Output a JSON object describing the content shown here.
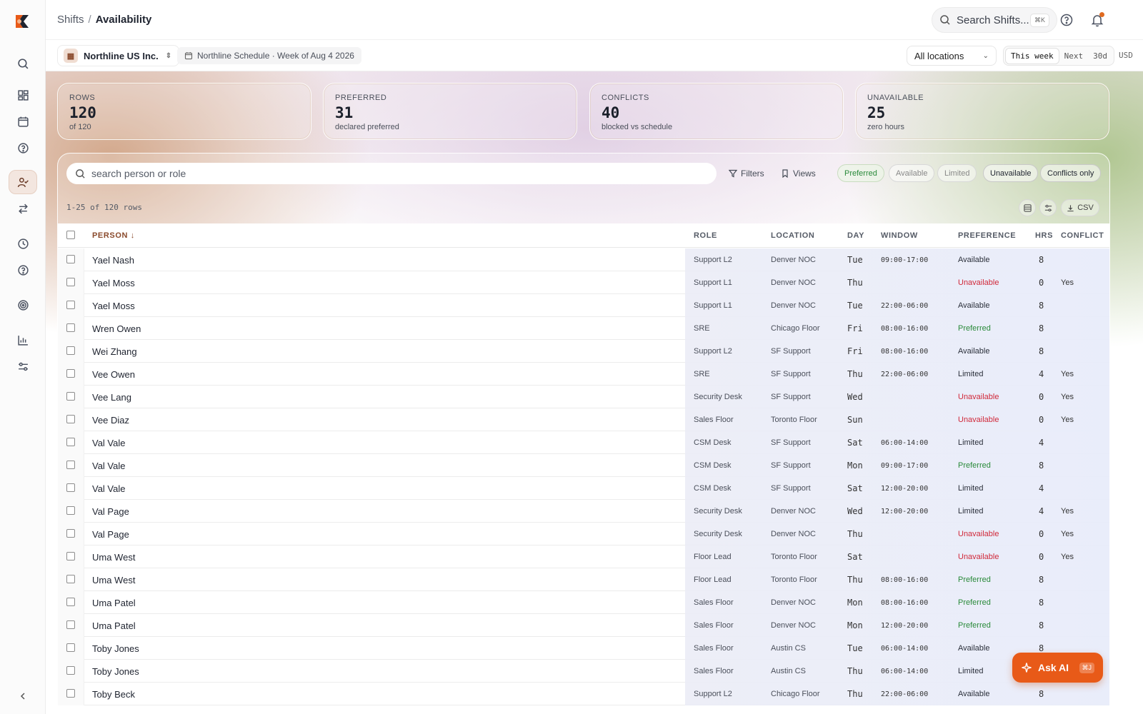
{
  "topbar": {
    "breadcrumb_parent": "Shifts",
    "breadcrumb_sep": "/",
    "breadcrumb_current": "Availability",
    "search_label": "Search Shifts...",
    "search_kbd": "⌘K"
  },
  "subbar": {
    "org_name": "Northline US Inc.",
    "schedule_label": "Northline Schedule · Week of Aug 4 2026",
    "location_value": "All locations",
    "ranges": [
      "This week",
      "Next",
      "30d"
    ],
    "active_range": "This week",
    "currency": "USD"
  },
  "stats": [
    {
      "label": "ROWS",
      "value": "120",
      "sub": "of 120"
    },
    {
      "label": "PREFERRED",
      "value": "31",
      "sub": "declared preferred"
    },
    {
      "label": "CONFLICTS",
      "value": "40",
      "sub": "blocked vs schedule"
    },
    {
      "label": "UNAVAILABLE",
      "value": "25",
      "sub": "zero hours"
    }
  ],
  "toolbar": {
    "search_placeholder": "search person or role",
    "filters_label": "Filters",
    "views_label": "Views",
    "chips": [
      "Preferred",
      "Available",
      "Limited",
      "Unavailable",
      "Conflicts only"
    ],
    "row_info": "1-25 of 120 rows",
    "csv_label": "CSV"
  },
  "table": {
    "headers": {
      "person": "PERSON",
      "role": "ROLE",
      "location": "LOCATION",
      "day": "DAY",
      "window": "WINDOW",
      "preference": "PREFERENCE",
      "hrs": "HRS",
      "conflict": "CONFLICT"
    },
    "sort_indicator": "↓",
    "rows": [
      {
        "person": "Yael Nash",
        "role": "Support L2",
        "location": "Denver NOC",
        "day": "Tue",
        "window": "09:00-17:00",
        "preference": "Available",
        "hrs": "8",
        "conflict": ""
      },
      {
        "person": "Yael Moss",
        "role": "Support L1",
        "location": "Denver NOC",
        "day": "Thu",
        "window": "",
        "preference": "Unavailable",
        "hrs": "0",
        "conflict": "Yes"
      },
      {
        "person": "Yael Moss",
        "role": "Support L1",
        "location": "Denver NOC",
        "day": "Tue",
        "window": "22:00-06:00",
        "preference": "Available",
        "hrs": "8",
        "conflict": ""
      },
      {
        "person": "Wren Owen",
        "role": "SRE",
        "location": "Chicago Floor",
        "day": "Fri",
        "window": "08:00-16:00",
        "preference": "Preferred",
        "hrs": "8",
        "conflict": ""
      },
      {
        "person": "Wei Zhang",
        "role": "Support L2",
        "location": "SF Support",
        "day": "Fri",
        "window": "08:00-16:00",
        "preference": "Available",
        "hrs": "8",
        "conflict": ""
      },
      {
        "person": "Vee Owen",
        "role": "SRE",
        "location": "SF Support",
        "day": "Thu",
        "window": "22:00-06:00",
        "preference": "Limited",
        "hrs": "4",
        "conflict": "Yes"
      },
      {
        "person": "Vee Lang",
        "role": "Security Desk",
        "location": "SF Support",
        "day": "Wed",
        "window": "",
        "preference": "Unavailable",
        "hrs": "0",
        "conflict": "Yes"
      },
      {
        "person": "Vee Diaz",
        "role": "Sales Floor",
        "location": "Toronto Floor",
        "day": "Sun",
        "window": "",
        "preference": "Unavailable",
        "hrs": "0",
        "conflict": "Yes"
      },
      {
        "person": "Val Vale",
        "role": "CSM Desk",
        "location": "SF Support",
        "day": "Sat",
        "window": "06:00-14:00",
        "preference": "Limited",
        "hrs": "4",
        "conflict": ""
      },
      {
        "person": "Val Vale",
        "role": "CSM Desk",
        "location": "SF Support",
        "day": "Mon",
        "window": "09:00-17:00",
        "preference": "Preferred",
        "hrs": "8",
        "conflict": ""
      },
      {
        "person": "Val Vale",
        "role": "CSM Desk",
        "location": "SF Support",
        "day": "Sat",
        "window": "12:00-20:00",
        "preference": "Limited",
        "hrs": "4",
        "conflict": ""
      },
      {
        "person": "Val Page",
        "role": "Security Desk",
        "location": "Denver NOC",
        "day": "Wed",
        "window": "12:00-20:00",
        "preference": "Limited",
        "hrs": "4",
        "conflict": "Yes"
      },
      {
        "person": "Val Page",
        "role": "Security Desk",
        "location": "Denver NOC",
        "day": "Thu",
        "window": "",
        "preference": "Unavailable",
        "hrs": "0",
        "conflict": "Yes"
      },
      {
        "person": "Uma West",
        "role": "Floor Lead",
        "location": "Toronto Floor",
        "day": "Sat",
        "window": "",
        "preference": "Unavailable",
        "hrs": "0",
        "conflict": "Yes"
      },
      {
        "person": "Uma West",
        "role": "Floor Lead",
        "location": "Toronto Floor",
        "day": "Thu",
        "window": "08:00-16:00",
        "preference": "Preferred",
        "hrs": "8",
        "conflict": ""
      },
      {
        "person": "Uma Patel",
        "role": "Sales Floor",
        "location": "Denver NOC",
        "day": "Mon",
        "window": "08:00-16:00",
        "preference": "Preferred",
        "hrs": "8",
        "conflict": ""
      },
      {
        "person": "Uma Patel",
        "role": "Sales Floor",
        "location": "Denver NOC",
        "day": "Mon",
        "window": "12:00-20:00",
        "preference": "Preferred",
        "hrs": "8",
        "conflict": ""
      },
      {
        "person": "Toby Jones",
        "role": "Sales Floor",
        "location": "Austin CS",
        "day": "Tue",
        "window": "06:00-14:00",
        "preference": "Available",
        "hrs": "8",
        "conflict": ""
      },
      {
        "person": "Toby Jones",
        "role": "Sales Floor",
        "location": "Austin CS",
        "day": "Thu",
        "window": "06:00-14:00",
        "preference": "Limited",
        "hrs": "",
        "conflict": ""
      },
      {
        "person": "Toby Beck",
        "role": "Support L2",
        "location": "Chicago Floor",
        "day": "Thu",
        "window": "22:00-06:00",
        "preference": "Available",
        "hrs": "8",
        "conflict": ""
      }
    ]
  },
  "ask_ai": {
    "label": "Ask AI",
    "kbd": "⌘J"
  },
  "colors": {
    "accent": "#e85a18",
    "preferred": "#2a8a3a",
    "unavailable": "#d0293a"
  }
}
